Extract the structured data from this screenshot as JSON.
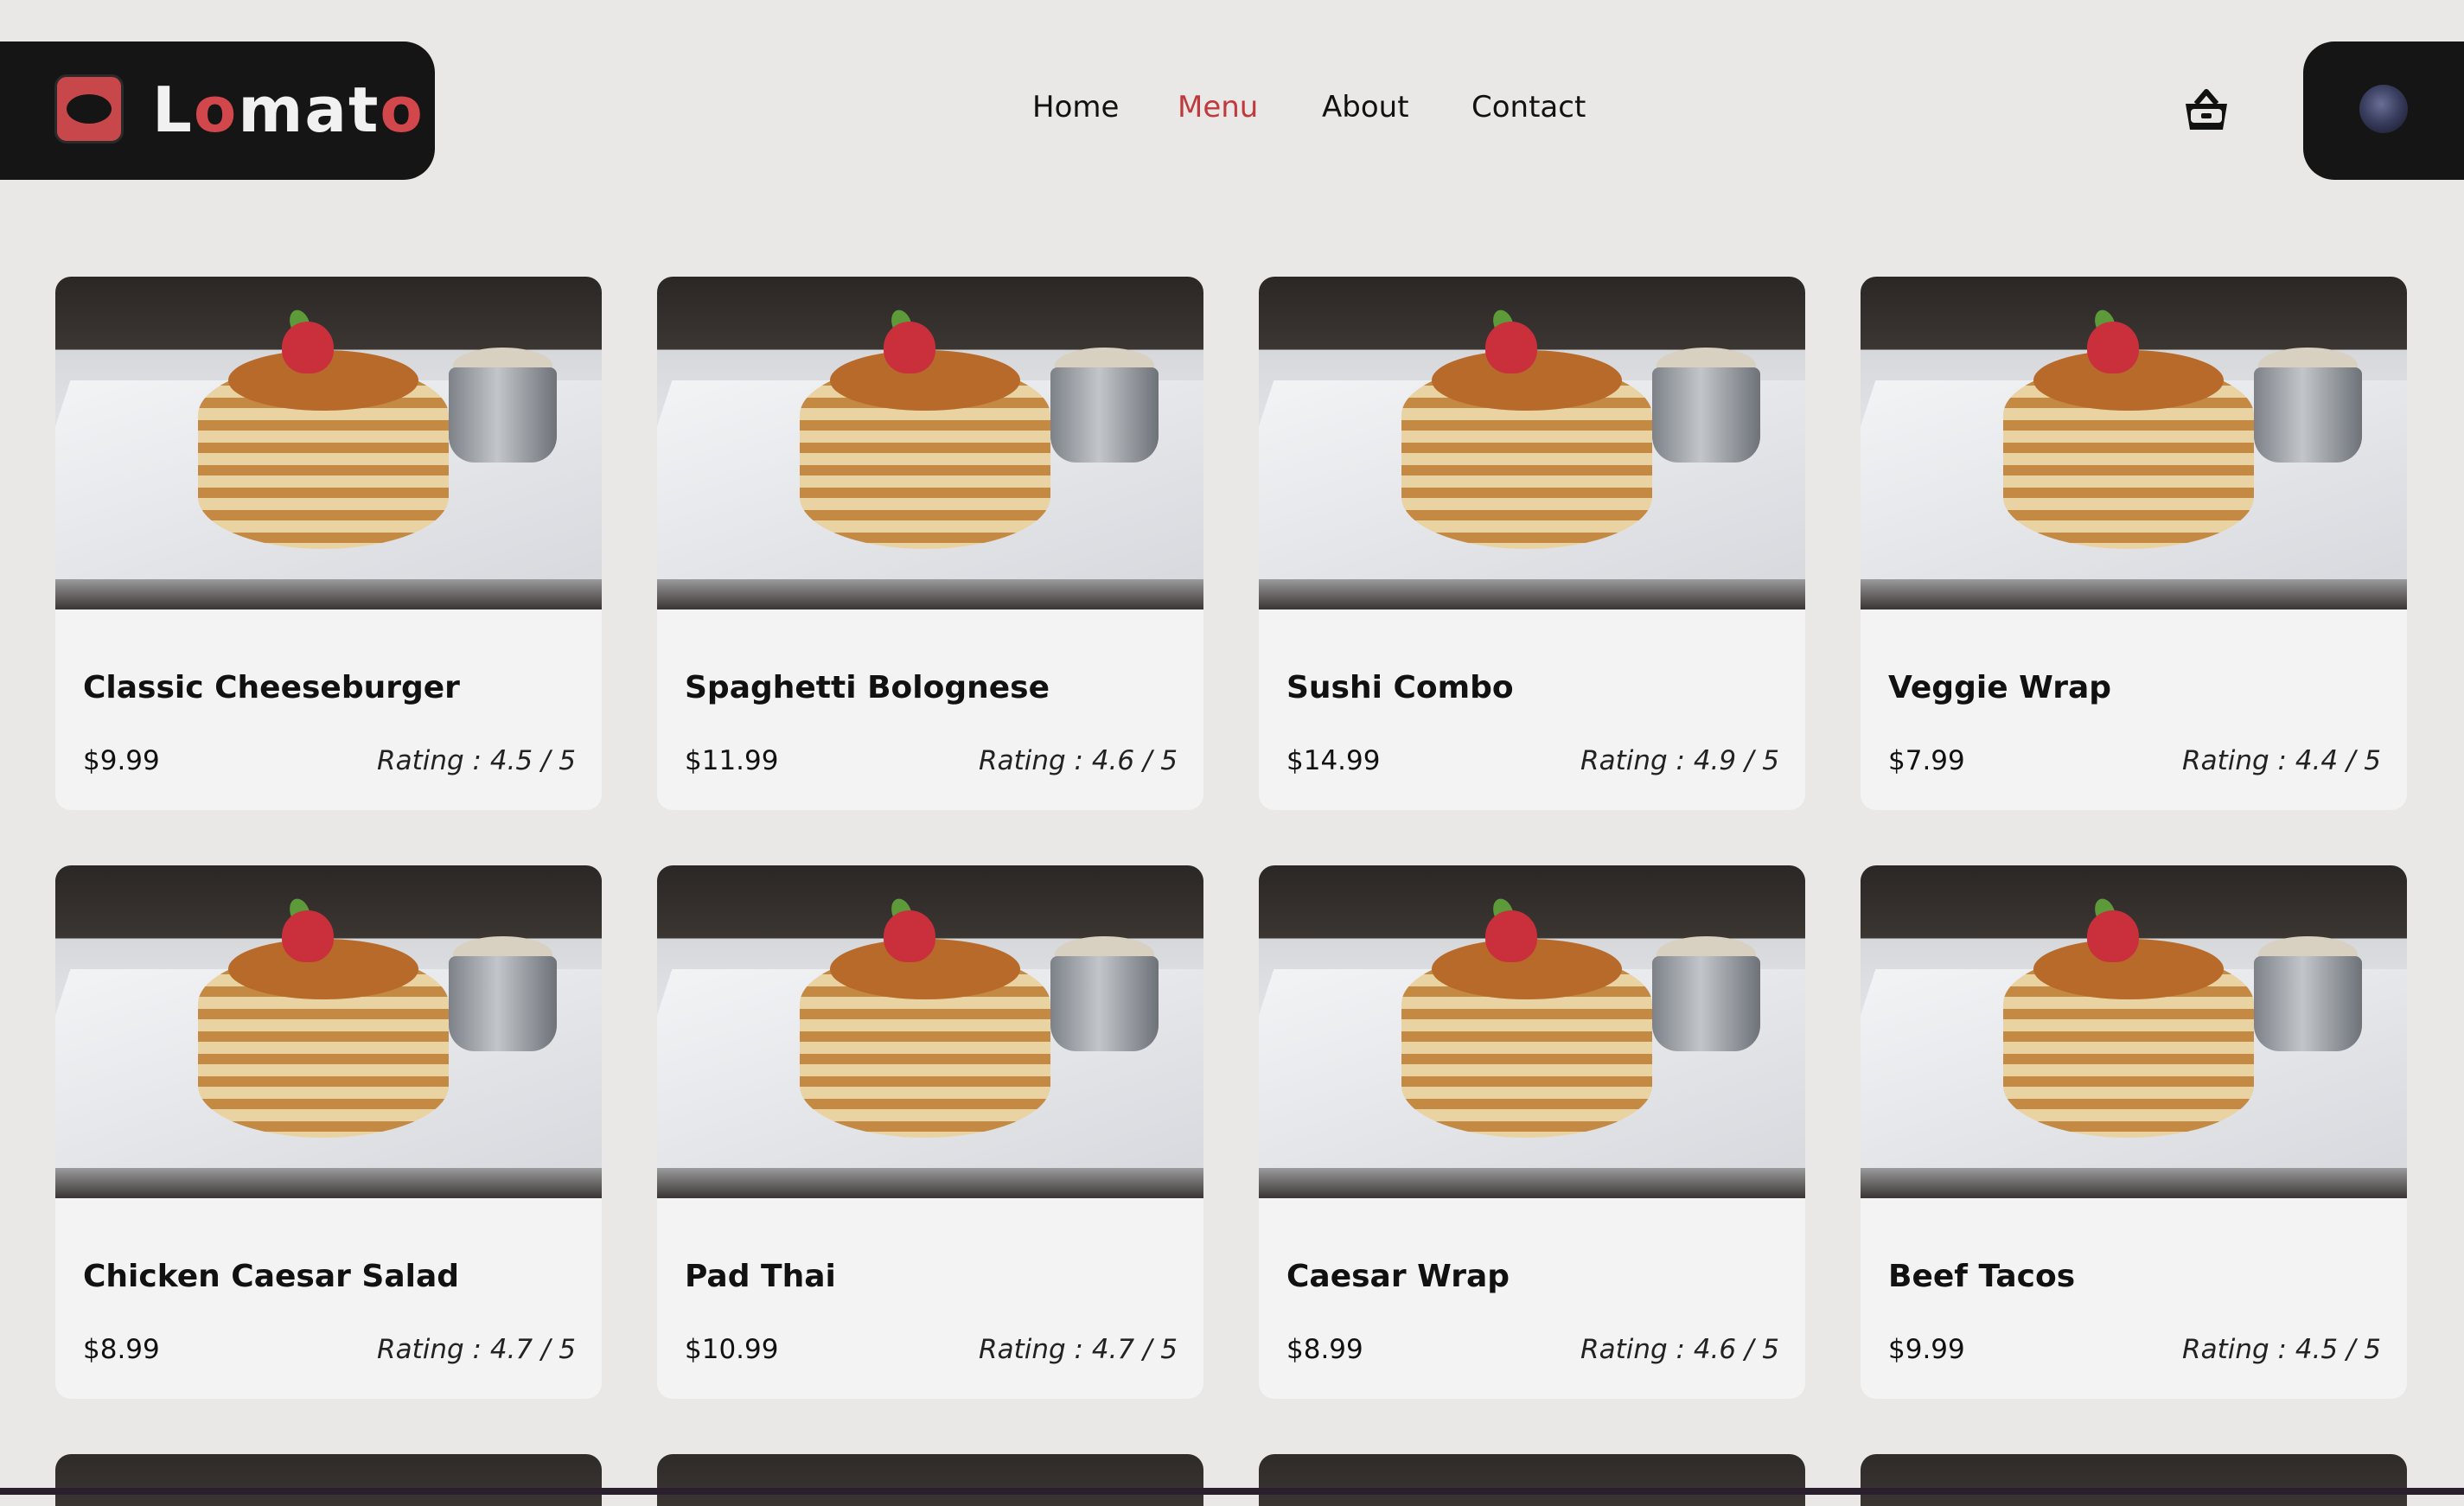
{
  "header": {
    "brand": {
      "prefix": "L",
      "o1": "o",
      "middle": "mat",
      "o2": "o"
    },
    "nav": [
      {
        "label": "Home",
        "active": false
      },
      {
        "label": "Menu",
        "active": true
      },
      {
        "label": "About",
        "active": false
      },
      {
        "label": "Contact",
        "active": false
      }
    ],
    "cart_icon": "basket-icon",
    "avatar_icon": "user-avatar"
  },
  "colors": {
    "accent": "#c0393d",
    "header_dark": "#151515",
    "background": "#e9e8e7",
    "card": "#f3f3f3"
  },
  "menu": {
    "items": [
      {
        "name": "Classic Cheeseburger",
        "price": "$9.99",
        "rating": "Rating : 4.5 / 5"
      },
      {
        "name": "Spaghetti Bolognese",
        "price": "$11.99",
        "rating": "Rating : 4.6 / 5"
      },
      {
        "name": "Sushi Combo",
        "price": "$14.99",
        "rating": "Rating : 4.9 / 5"
      },
      {
        "name": "Veggie Wrap",
        "price": "$7.99",
        "rating": "Rating : 4.4 / 5"
      },
      {
        "name": "Chicken Caesar Salad",
        "price": "$8.99",
        "rating": "Rating : 4.7 / 5"
      },
      {
        "name": "Pad Thai",
        "price": "$10.99",
        "rating": "Rating : 4.7 / 5"
      },
      {
        "name": "Caesar Wrap",
        "price": "$8.99",
        "rating": "Rating : 4.6 / 5"
      },
      {
        "name": "Beef Tacos",
        "price": "$9.99",
        "rating": "Rating : 4.5 / 5"
      }
    ]
  }
}
